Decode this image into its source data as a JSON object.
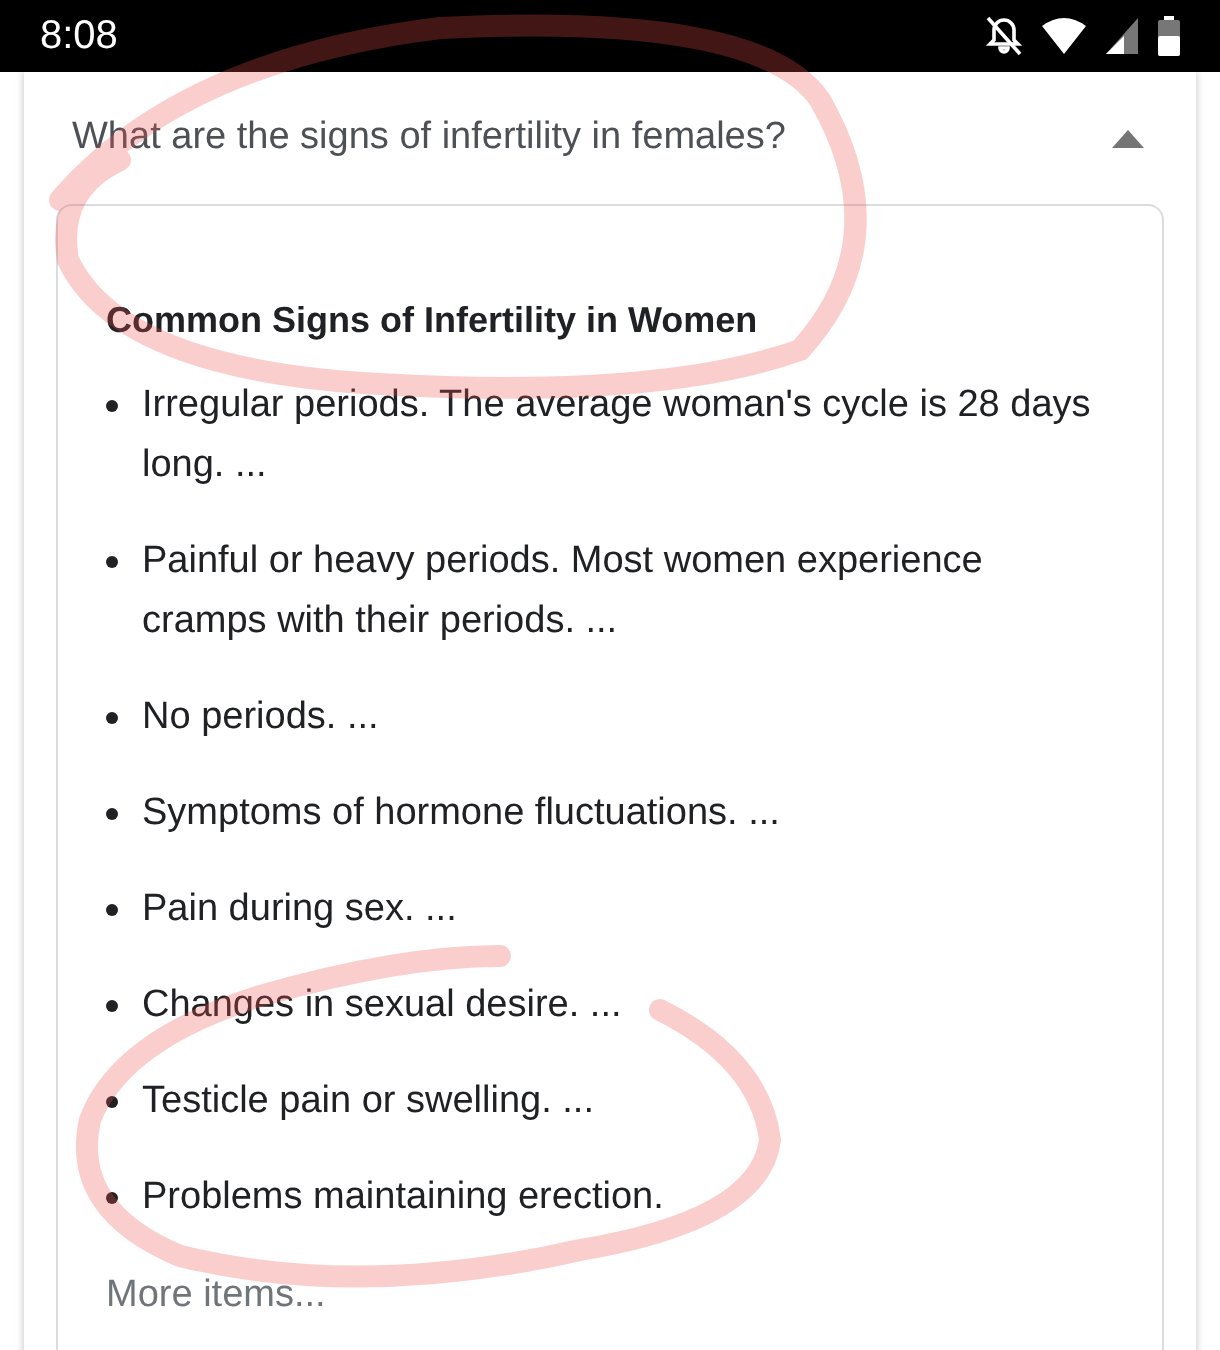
{
  "status_bar": {
    "time": "8:08"
  },
  "question": {
    "text": "What are the signs of infertility in females?",
    "expanded": true
  },
  "answer": {
    "heading": "Common Signs of Infertility in Women",
    "items": [
      "Irregular periods. The average woman's cycle is 28 days long. ...",
      "Painful or heavy periods. Most women experience cramps with their periods. ...",
      "No periods. ...",
      "Symptoms of hormone fluctuations. ...",
      "Pain during sex. ...",
      "Changes in sexual desire. ...",
      "Testicle pain or swelling. ...",
      "Problems maintaining erection."
    ],
    "more_link": "More items..."
  }
}
